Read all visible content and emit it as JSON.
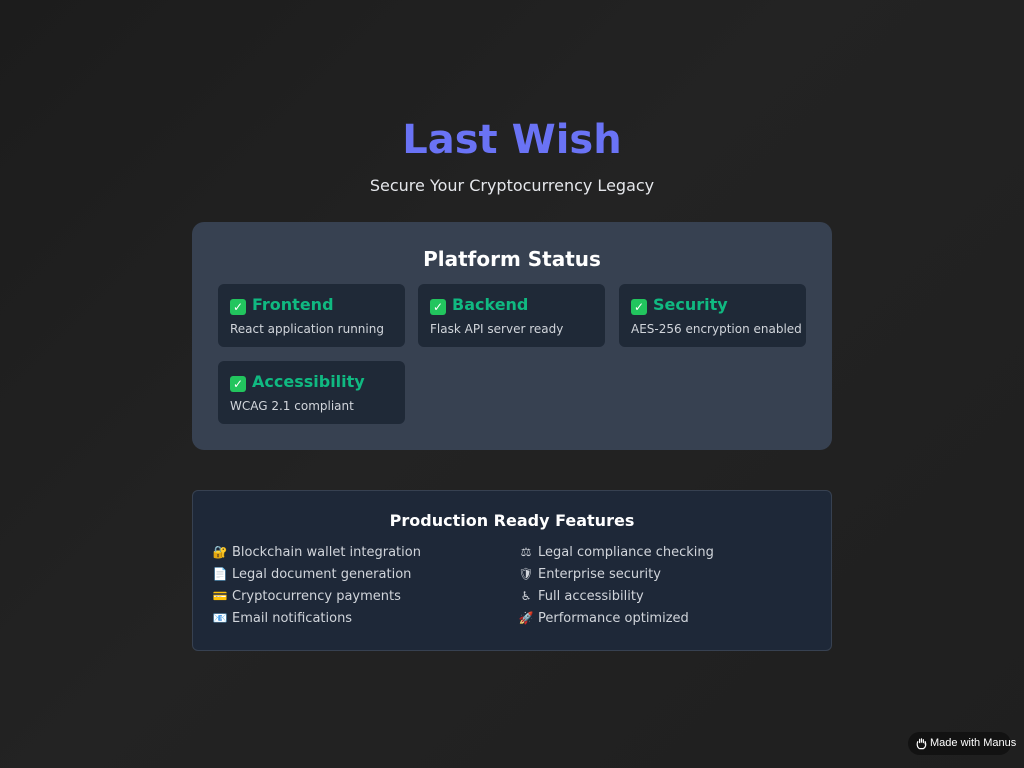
{
  "hero": {
    "title": "Last Wish",
    "subtitle": "Secure Your Cryptocurrency Legacy"
  },
  "status": {
    "title": "Platform Status",
    "status_color": "#10b981",
    "cards": [
      {
        "icon": "check-mark-icon",
        "title": "Frontend",
        "description": "React application running"
      },
      {
        "icon": "check-mark-icon",
        "title": "Backend",
        "description": "Flask API server ready"
      },
      {
        "icon": "check-mark-icon",
        "title": "Security",
        "description": "AES-256 encryption enabled"
      },
      {
        "icon": "check-mark-icon",
        "title": "Accessibility",
        "description": "WCAG 2.1 compliant"
      }
    ]
  },
  "features": {
    "title": "Production Ready Features",
    "items": [
      {
        "icon": "lock-with-key-icon",
        "glyph": "🔐",
        "label": "Blockchain wallet integration"
      },
      {
        "icon": "document-icon",
        "glyph": "📄",
        "label": "Legal document generation"
      },
      {
        "icon": "credit-card-icon",
        "glyph": "💳",
        "label": "Cryptocurrency payments"
      },
      {
        "icon": "email-icon",
        "glyph": "📧",
        "label": "Email notifications"
      },
      {
        "icon": "balance-scale-icon",
        "glyph": "⚖",
        "label": "Legal compliance checking"
      },
      {
        "icon": "shield-icon",
        "glyph": "🛡",
        "label": "Enterprise security"
      },
      {
        "icon": "wheelchair-icon",
        "glyph": "♿",
        "label": "Full accessibility"
      },
      {
        "icon": "rocket-icon",
        "glyph": "🚀",
        "label": "Performance optimized"
      }
    ]
  },
  "badge": {
    "icon": "manus-hand-icon",
    "label": "Made with Manus"
  },
  "colors": {
    "accent": "#6a73f5",
    "background": "#1e1e1e",
    "panel": "#374151",
    "card": "#1f2937"
  }
}
